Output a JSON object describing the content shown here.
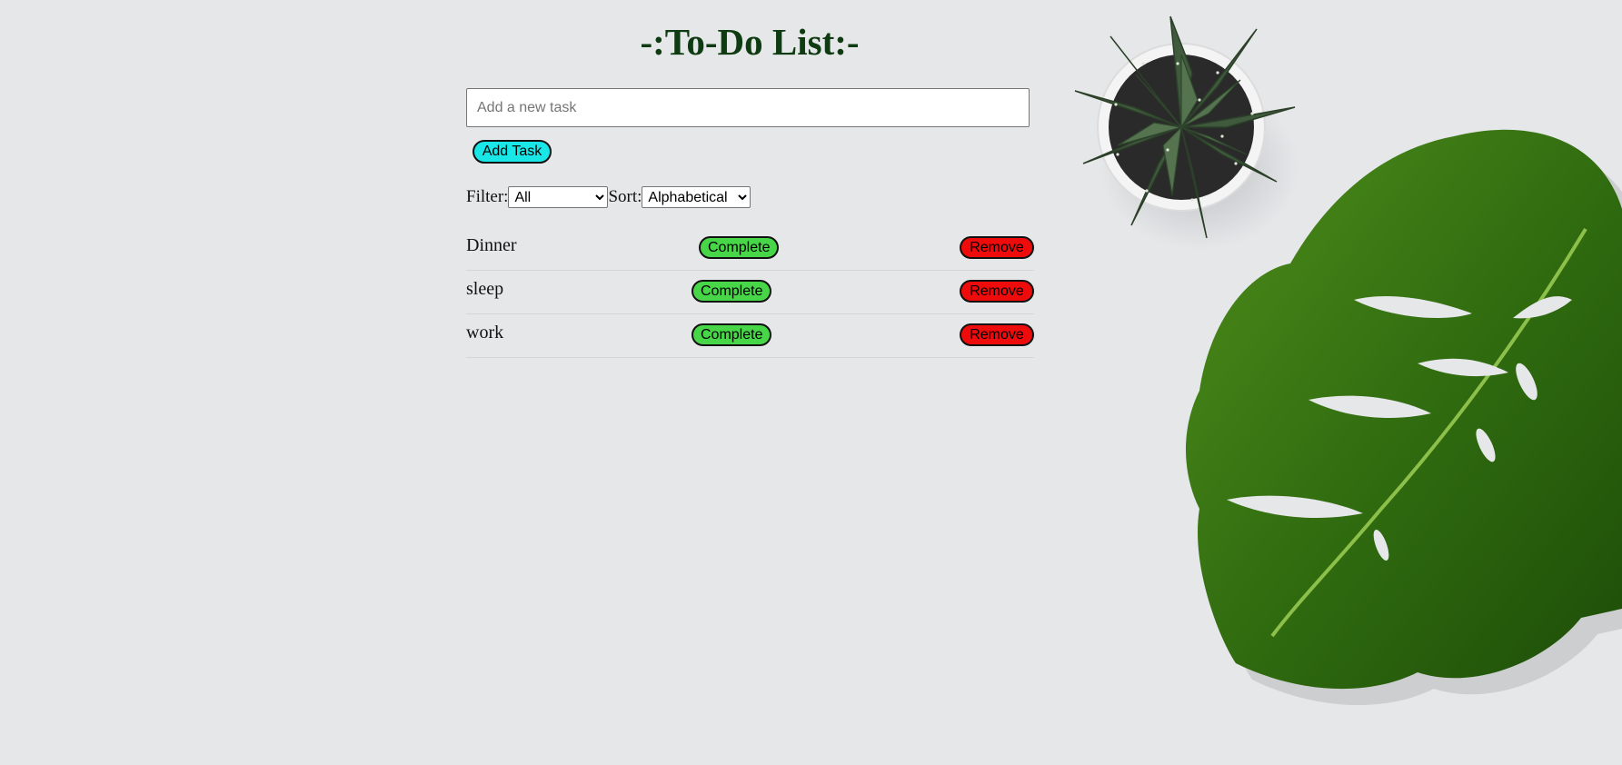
{
  "header": {
    "title": "-:To-Do List:-"
  },
  "task_input": {
    "placeholder": "Add a new task",
    "value": ""
  },
  "add_button": {
    "label": "Add Task"
  },
  "filter": {
    "label": "Filter:",
    "selected": "All"
  },
  "sort": {
    "label": "Sort:",
    "selected": "Alphabetical"
  },
  "tasks": [
    {
      "name": "Dinner",
      "complete_label": "Complete",
      "remove_label": "Remove"
    },
    {
      "name": "sleep",
      "complete_label": "Complete",
      "remove_label": "Remove"
    },
    {
      "name": "work",
      "complete_label": "Complete",
      "remove_label": "Remove"
    }
  ],
  "colors": {
    "background": "#e6e7e9",
    "title": "#0f3b12",
    "add_button": "#19e6e6",
    "complete_button": "#47d647",
    "remove_button": "#ee0b0b"
  },
  "decorations": {
    "plant_top": "succulent-in-white-pot",
    "leaf_right": "monstera-leaf"
  }
}
